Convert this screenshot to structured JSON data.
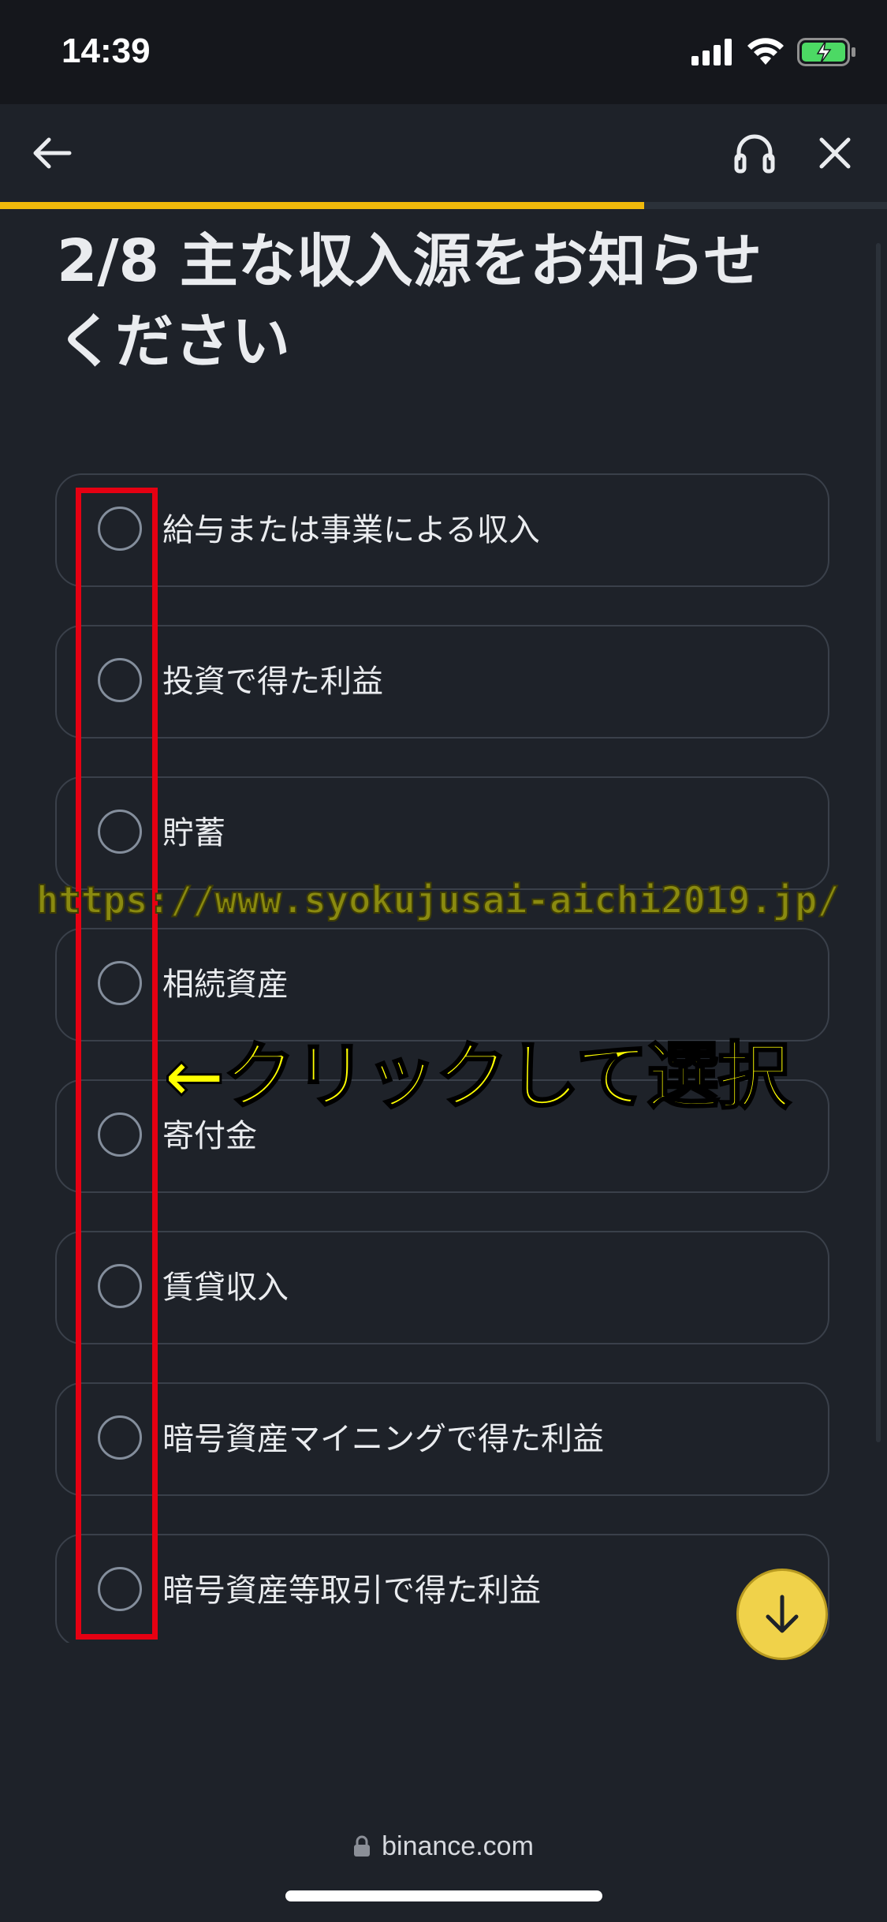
{
  "status_bar": {
    "time": "14:39",
    "icons": [
      "signal-icon",
      "wifi-icon",
      "battery-charging-icon"
    ]
  },
  "nav": {
    "icons": [
      "back-arrow-icon",
      "headset-icon",
      "close-icon"
    ]
  },
  "progress": {
    "value": 0.726,
    "color": "#f0b90b"
  },
  "question": {
    "title": "2/8 主な収入源をお知らせください"
  },
  "options": [
    {
      "label": "給与または事業による収入"
    },
    {
      "label": "投資で得た利益"
    },
    {
      "label": "貯蓄"
    },
    {
      "label": "相続資産"
    },
    {
      "label": "寄付金"
    },
    {
      "label": "賃貸収入"
    },
    {
      "label": "暗号資産マイニングで得た利益"
    },
    {
      "label": "暗号資産等取引で得た利益"
    }
  ],
  "scroll_fab": {
    "icon": "arrow-down-icon"
  },
  "footer": {
    "url": "binance.com",
    "icon": "lock-icon"
  },
  "annotations": {
    "watermark": "https://www.syokujusai-aichi2019.jp/",
    "instruction": "←クリックして選択",
    "highlight_color": "#e60012",
    "instruction_color": "#ffff00"
  }
}
